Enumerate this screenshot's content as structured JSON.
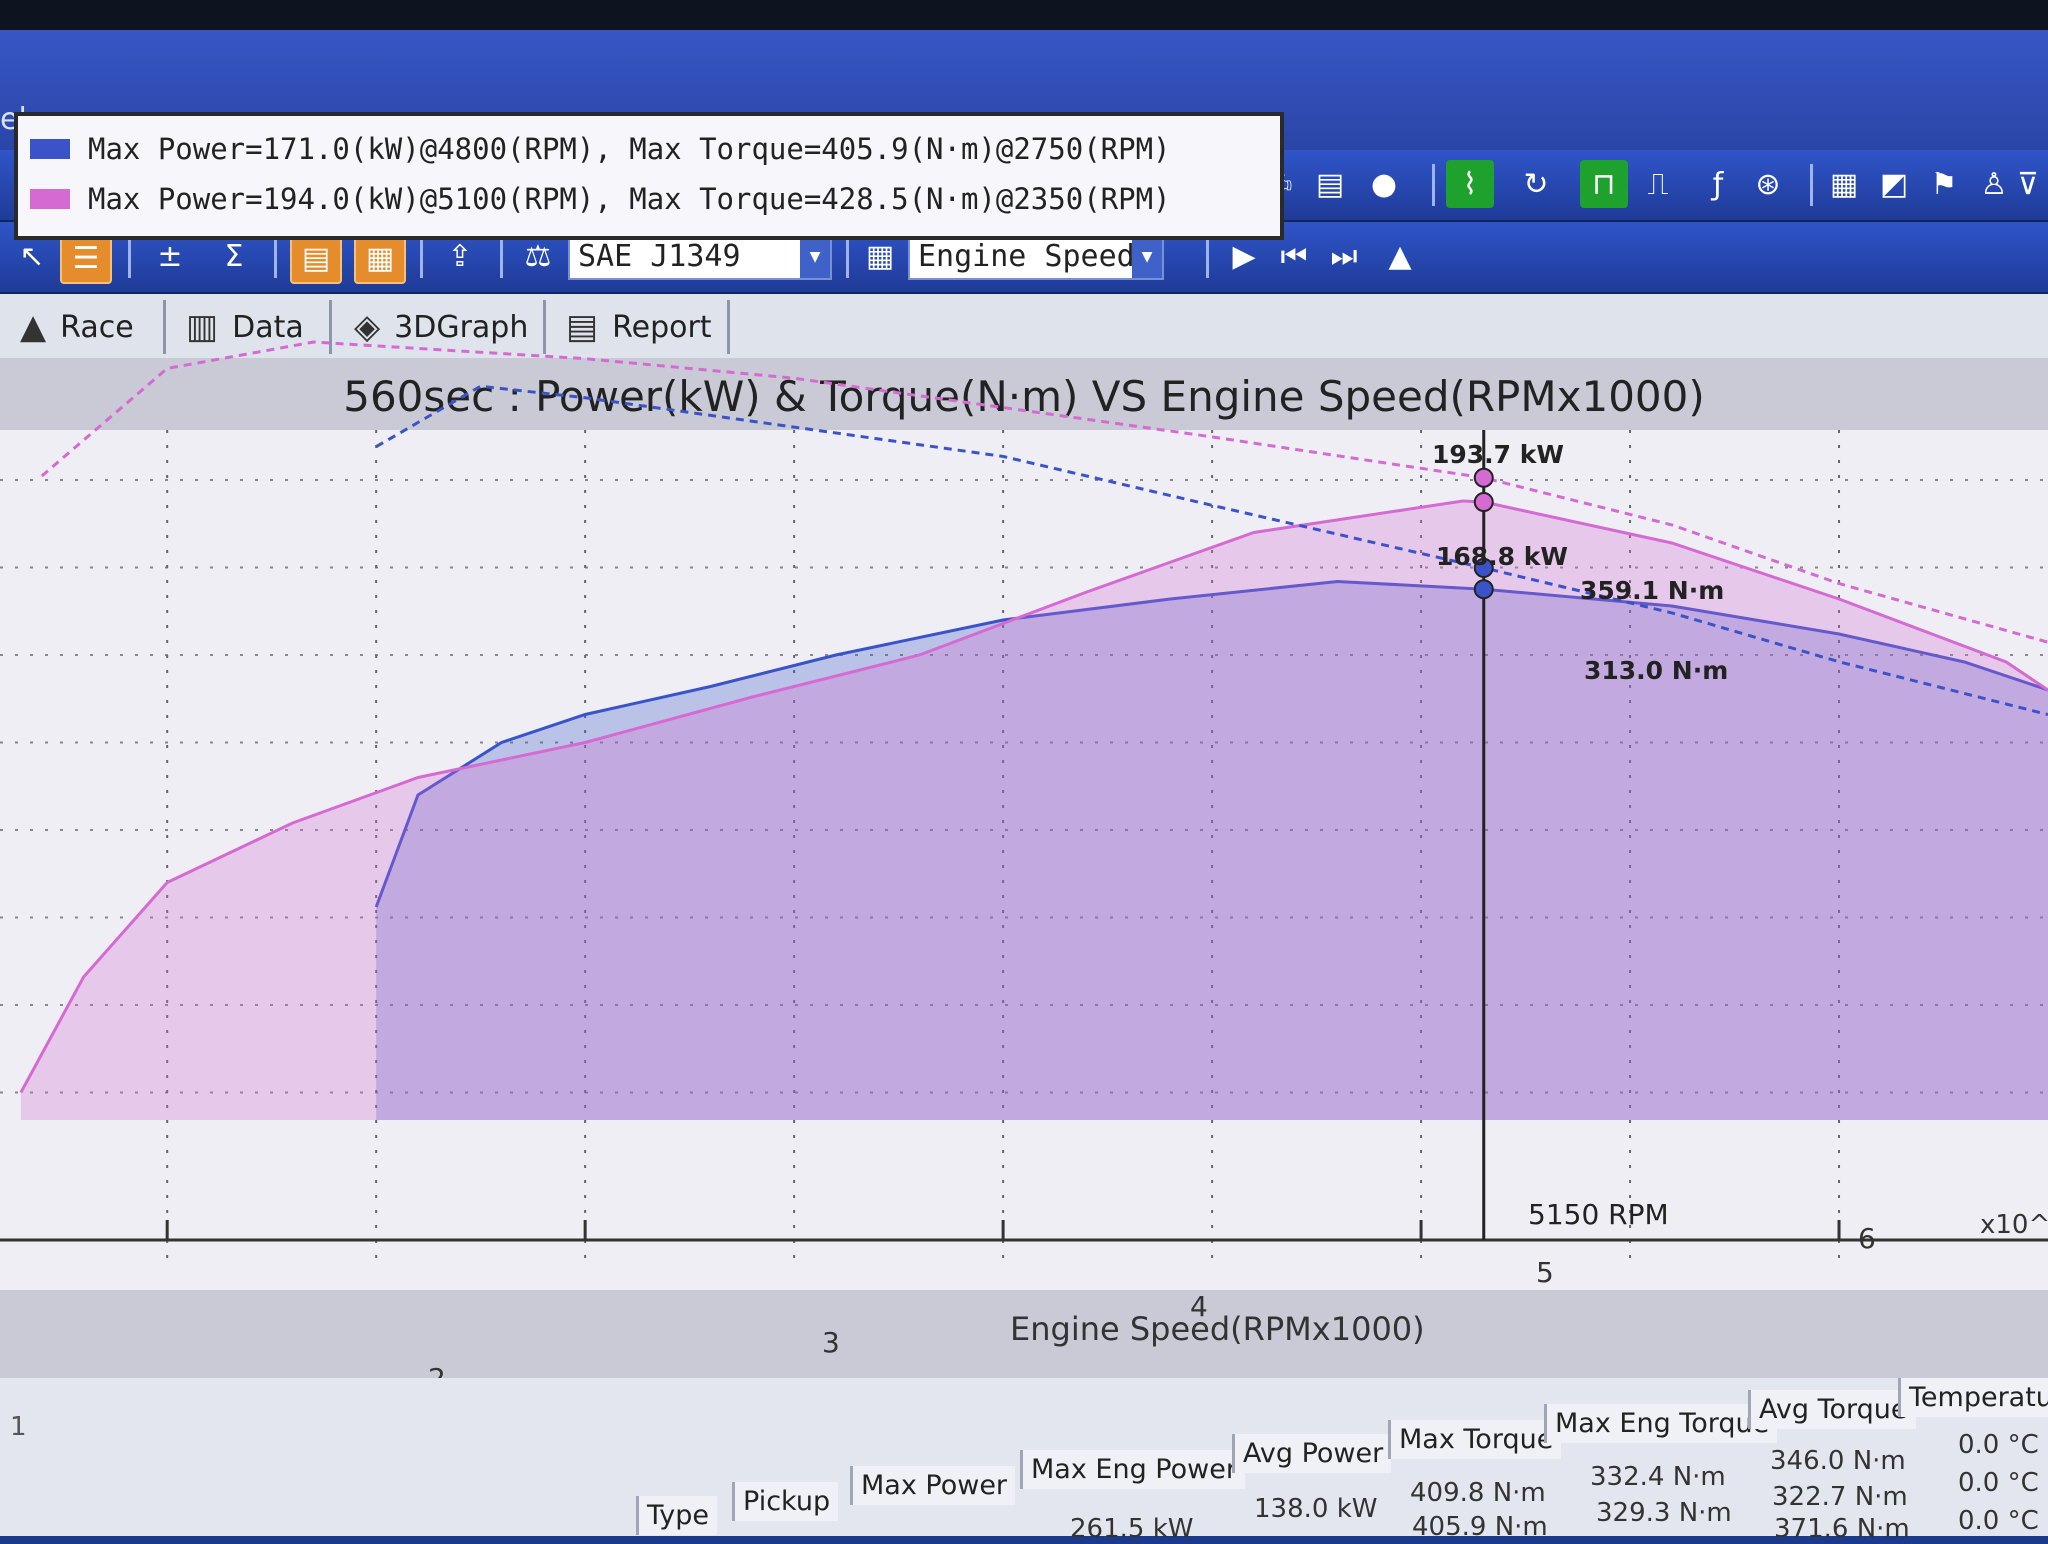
{
  "menubar": {
    "help_label": "elp"
  },
  "toolbar2": {
    "standard_select": "SAE J1349",
    "axis_select": "Engine Speed"
  },
  "tabs": [
    {
      "label": "Race"
    },
    {
      "label": "Data"
    },
    {
      "label": "3DGraph"
    },
    {
      "label": "Report"
    }
  ],
  "chart": {
    "title": "560sec : Power(kW) & Torque(N·m) VS Engine Speed(RPMx1000)",
    "legend": [
      {
        "text": "Max Power=171.0(kW)@4800(RPM), Max Torque=405.9(N·m)@2750(RPM)",
        "color": "#3b53c9"
      },
      {
        "text": "Max Power=194.0(kW)@5100(RPM), Max Torque=428.5(N·m)@2350(RPM)",
        "color": "#d56bd2"
      }
    ],
    "cursor_rpm_label": "5150 RPM",
    "annotations": {
      "p1": "193.7 kW",
      "p2": "168.8 kW",
      "t1": "359.1 N·m",
      "t2": "313.0 N·m"
    },
    "xlabel": "Engine Speed(RPMx1000)",
    "x_multiplier": "x10^",
    "x_ticks": [
      "2",
      "3",
      "4",
      "5",
      "6"
    ]
  },
  "chart_data": {
    "type": "line",
    "title": "560sec : Power(kW) & Torque(N·m) VS Engine Speed(RPMx1000)",
    "xlabel": "Engine Speed(RPMx1000)",
    "ylabel": "",
    "xlim": [
      1.6,
      6.5
    ],
    "ylim_power": [
      0,
      200
    ],
    "ylim_torque": [
      0,
      450
    ],
    "cursor_x": 5.15,
    "series": [
      {
        "name": "Max Power=171.0(kW)@4800(RPM), Max Torque=405.9(N·m)@2750(RPM)",
        "kind": "power",
        "color": "#3b53c9",
        "x": [
          2.5,
          2.6,
          2.8,
          3.0,
          3.3,
          3.6,
          4.0,
          4.4,
          4.8,
          5.15,
          5.6,
          6.0,
          6.3,
          6.5
        ],
        "values": [
          78,
          110,
          125,
          133,
          141,
          150,
          160,
          166,
          171,
          168.8,
          164,
          156,
          148,
          140
        ]
      },
      {
        "name": "Max Power=194.0(kW)@5100(RPM), Max Torque=428.5(N·m)@2350(RPM)",
        "kind": "power",
        "color": "#d56bd2",
        "x": [
          1.65,
          1.8,
          2.0,
          2.3,
          2.6,
          3.0,
          3.4,
          3.8,
          4.2,
          4.6,
          5.1,
          5.15,
          5.6,
          6.0,
          6.4,
          6.5
        ],
        "values": [
          25,
          58,
          85,
          102,
          115,
          125,
          138,
          150,
          168,
          185,
          194,
          193.7,
          182,
          166,
          148,
          140
        ]
      },
      {
        "name": "Max Power=171.0(kW)@4800(RPM), Max Torque=405.9(N·m)@2750(RPM)",
        "kind": "torque",
        "color": "#3b53c9",
        "x": [
          2.5,
          2.75,
          3.0,
          3.5,
          4.0,
          4.5,
          5.15,
          5.6,
          6.0,
          6.5
        ],
        "values": [
          375,
          405.9,
          400,
          385,
          370,
          345,
          313.0,
          290,
          265,
          238
        ]
      },
      {
        "name": "Max Power=194.0(kW)@5100(RPM), Max Torque=428.5(N·m)@2350(RPM)",
        "kind": "torque",
        "color": "#d56bd2",
        "x": [
          1.7,
          2.0,
          2.35,
          3.0,
          3.5,
          4.0,
          4.5,
          5.15,
          5.6,
          6.0,
          6.5
        ],
        "values": [
          360,
          415,
          428.5,
          420,
          410,
          395,
          380,
          359.1,
          335,
          305,
          275
        ]
      }
    ]
  },
  "summary": {
    "headers": [
      "Type",
      "Pickup",
      "Max Power",
      "Max Eng Power",
      "Avg Power",
      "Max Torque",
      "Max Eng Torque",
      "Avg Torque",
      "Temperature"
    ],
    "row_label": "1",
    "rows": [
      [
        "",
        "",
        "",
        "261.5 kW",
        "138.0 kW",
        "409.8 N·m",
        "332.4 N·m",
        "346.0 N·m",
        "0.0 °C"
      ],
      [
        "",
        "",
        "",
        "",
        "",
        "405.9 N·m",
        "329.3 N·m",
        "322.7 N·m",
        "0.0 °C"
      ],
      [
        "",
        "",
        "",
        "",
        "",
        "",
        "",
        "371.6 N·m",
        "0.0 °C"
      ]
    ]
  }
}
